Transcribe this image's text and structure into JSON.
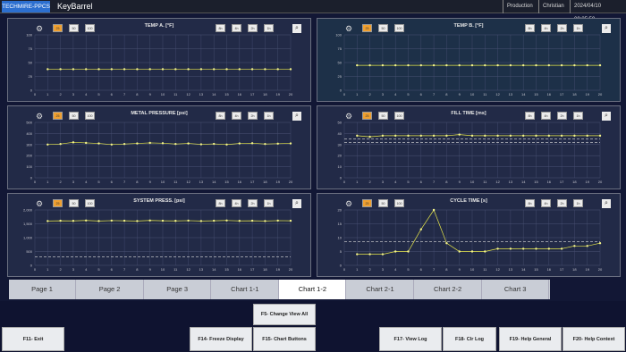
{
  "titlebar": {
    "brand": "TECHMIRE-PPCS",
    "title": "KeyBarrel",
    "mode": "Production",
    "user": "Christian",
    "datetime": "2024/04/10 09:35:59"
  },
  "toolbar": {
    "btn_count1": "25",
    "btn_count2": "50",
    "btn_count3": "100",
    "btn_period1": "8h",
    "btn_period2": "4h",
    "btn_period3": "2h",
    "btn_period4": "1h",
    "settings_icon": "gear-icon",
    "zoom_icon": "search-icon"
  },
  "charts": [
    {
      "title": "TEMP A. [°F]",
      "yticks": [
        "100",
        "75",
        "50",
        "25",
        "0"
      ],
      "ylim": [
        0,
        100
      ],
      "values": [
        38,
        38,
        38,
        38,
        38,
        38,
        38,
        38,
        38,
        38,
        38,
        38,
        38,
        38,
        38,
        38,
        38,
        38,
        38,
        38
      ],
      "highlight": false
    },
    {
      "title": "TEMP B. [°F]",
      "yticks": [
        "100",
        "75",
        "50",
        "25",
        "0"
      ],
      "ylim": [
        0,
        100
      ],
      "values": [
        45,
        45,
        45,
        45,
        45,
        45,
        45,
        45,
        45,
        45,
        45,
        45,
        45,
        45,
        45,
        45,
        45,
        45,
        45,
        45
      ],
      "highlight": true
    },
    {
      "title": "METAL PRESSURE [psi]",
      "yticks": [
        "500",
        "400",
        "300",
        "200",
        "100",
        "0"
      ],
      "ylim": [
        0,
        500
      ],
      "values": [
        300,
        305,
        320,
        315,
        310,
        300,
        305,
        310,
        315,
        312,
        305,
        310,
        302,
        306,
        300,
        310,
        312,
        305,
        308,
        310
      ],
      "highlight": false
    },
    {
      "title": "FILL TIME [ms]",
      "yticks": [
        "50",
        "40",
        "30",
        "20",
        "10",
        "0"
      ],
      "ylim": [
        0,
        50
      ],
      "values": [
        38,
        37,
        38,
        38,
        38,
        38,
        38,
        38,
        39,
        38,
        38,
        38,
        38,
        38,
        38,
        38,
        38,
        38,
        38,
        38
      ],
      "limit_lines": [
        35,
        32
      ],
      "highlight": false
    },
    {
      "title": "SYSTEM PRESS. [psi]",
      "yticks": [
        "2,000",
        "1,500",
        "1,000",
        "500",
        "0"
      ],
      "ylim": [
        0,
        2000
      ],
      "values": [
        1600,
        1610,
        1605,
        1620,
        1600,
        1615,
        1610,
        1600,
        1620,
        1610,
        1605,
        1615,
        1600,
        1610,
        1620,
        1605,
        1610,
        1600,
        1615,
        1610
      ],
      "limit_lines": [
        300
      ],
      "highlight": false
    },
    {
      "title": "CYCLE TIME [s]",
      "yticks": [
        "20",
        "15",
        "10",
        "5",
        "0"
      ],
      "ylim": [
        0,
        20
      ],
      "values": [
        4,
        4,
        4,
        5,
        5,
        13,
        31,
        8,
        5,
        5,
        5,
        6,
        6,
        6,
        6,
        6,
        6,
        7,
        7,
        8
      ],
      "limit_lines": [
        8.5
      ],
      "highlight": false
    }
  ],
  "xticks": [
    "0",
    "1",
    "2",
    "3",
    "4",
    "5",
    "6",
    "7",
    "8",
    "9",
    "10",
    "11",
    "12",
    "13",
    "14",
    "15",
    "16",
    "17",
    "18",
    "19",
    "20"
  ],
  "tabs": [
    "Page 1",
    "Page 2",
    "Page 3",
    "Chart 1-1",
    "Chart 1-2",
    "Chart 2-1",
    "Chart 2-2",
    "Chart 3"
  ],
  "fkeys": {
    "f11": "F11- Exit",
    "f5": "F5- Change View All",
    "f14": "F14- Freeze Display",
    "f15": "F15- Chart Buttons",
    "f17": "F17- View Log",
    "f18": "F18- Clr Log",
    "f19": "F19- Help General",
    "f20": "F20- Help Context"
  },
  "colors": {
    "series": "#e8e84a",
    "point": "#f4f48a",
    "grid": "#4a5275",
    "limit": "#dcdcdc",
    "active_button": "#f0a030"
  }
}
